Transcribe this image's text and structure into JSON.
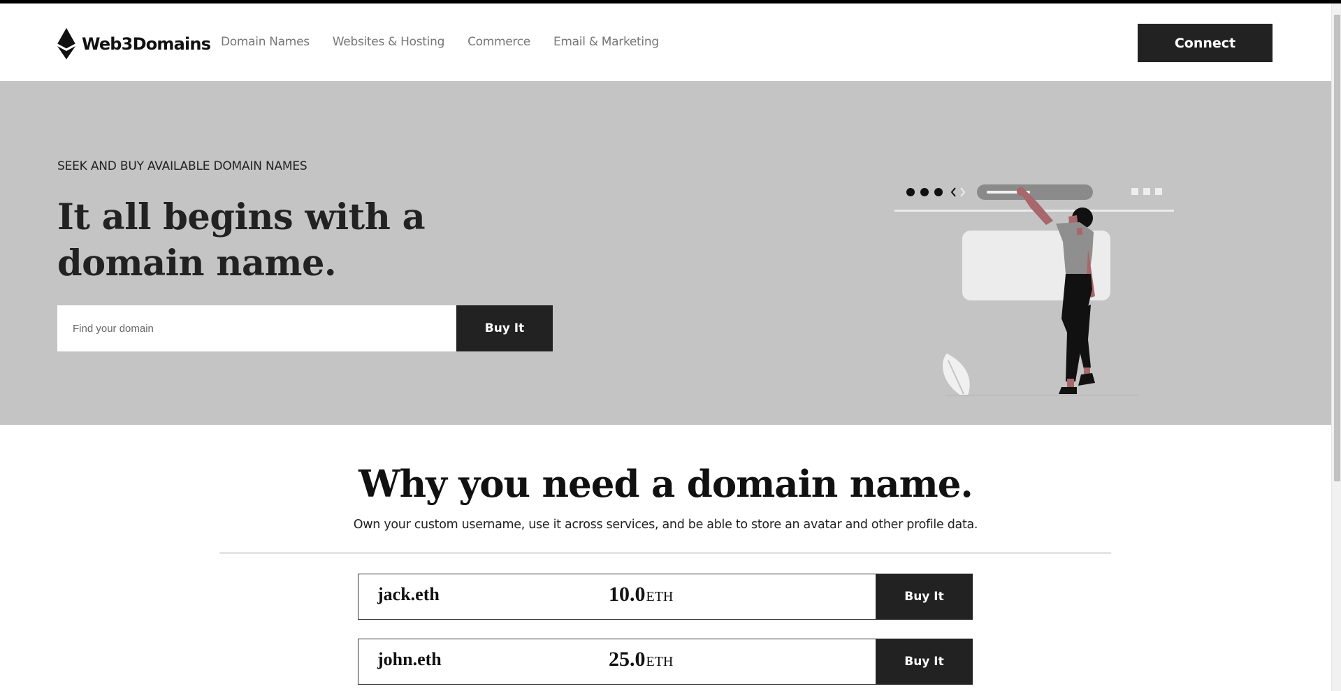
{
  "brand": {
    "name": "Web3Domains",
    "logo_icon": "ethereum-diamond-icon"
  },
  "nav": {
    "items": [
      {
        "label": "Domain Names"
      },
      {
        "label": "Websites & Hosting"
      },
      {
        "label": "Commerce"
      },
      {
        "label": "Email & Marketing"
      }
    ]
  },
  "header": {
    "connect_label": "Connect"
  },
  "hero": {
    "eyebrow": "SEEK AND BUY AVAILABLE DOMAIN NAMES",
    "title": "It all begins with a domain name.",
    "search_placeholder": "Find your domain",
    "search_value": "",
    "buy_label": "Buy It"
  },
  "why": {
    "title": "Why you need a domain name.",
    "subtitle": "Own your custom username, use it across services, and be able to store an avatar and other profile data."
  },
  "domains": [
    {
      "name": "jack.eth",
      "price": "10.0",
      "unit": "ETH",
      "buy_label": "Buy It"
    },
    {
      "name": "john.eth",
      "price": "25.0",
      "unit": "ETH",
      "buy_label": "Buy It"
    }
  ],
  "colors": {
    "hero_bg": "#c4c4c4",
    "button_bg": "#222222",
    "accent_figure": "#a8676a"
  }
}
